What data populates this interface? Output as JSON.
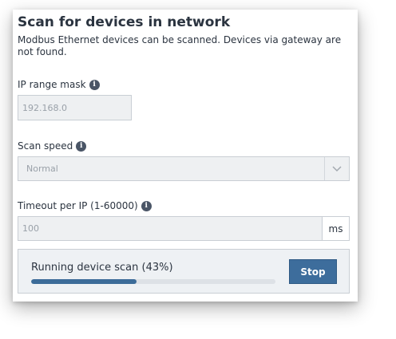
{
  "dialog": {
    "title": "Scan for devices in network",
    "subtitle": "Modbus Ethernet devices can be scanned. Devices via gateway are not found."
  },
  "ip_range": {
    "label": "IP range mask",
    "info_icon": "info-icon",
    "placeholder": "192.168.0"
  },
  "scan_speed": {
    "label": "Scan speed",
    "info_icon": "info-icon",
    "selected": "Normal",
    "dropdown_icon": "chevron-down-icon"
  },
  "timeout": {
    "label": "Timeout per IP (1-60000)",
    "info_icon": "info-icon",
    "placeholder": "100",
    "unit": "ms"
  },
  "scan_progress": {
    "text": "Running device scan (43%)",
    "percent": 43,
    "stop_label": "Stop"
  },
  "colors": {
    "accent": "#3d6d9c",
    "progress_fill": "#3c6c99",
    "text": "#2b3440",
    "disabled_field": "#eef0f2"
  }
}
